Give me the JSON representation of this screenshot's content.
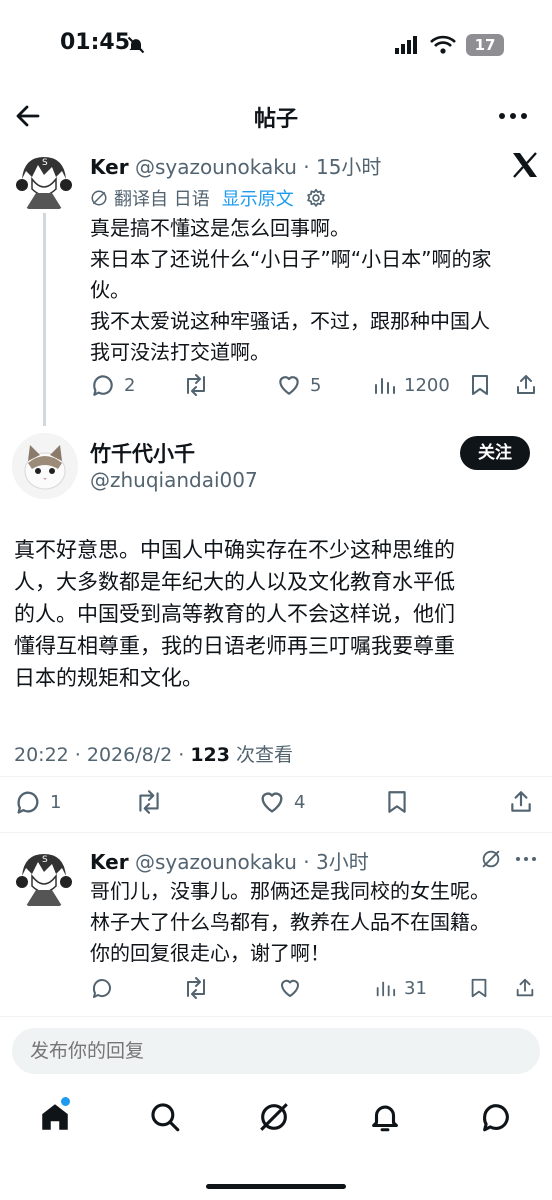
{
  "status_bar": {
    "time": "01:45",
    "battery": "17"
  },
  "header": {
    "title": "帖子"
  },
  "tweet1": {
    "display_name": "Ker",
    "handle": "@syazounokaku",
    "time": "15小时",
    "translated_label": "翻译自 日语",
    "show_original": "显示原文",
    "lines": [
      "真是搞不懂这是怎么回事啊。",
      "来日本了还说什么“小日子”啊“小日本”啊的家",
      "伙。",
      "我不太爱说这种牢骚话，不过，跟那种中国人",
      "我可没法打交道啊。"
    ],
    "replies": "2",
    "likes": "5",
    "views": "1200"
  },
  "main_tweet": {
    "display_name": "竹千代小千",
    "handle": "@zhuqiandai007",
    "follow_label": "关注",
    "lines": [
      "真不好意思。中国人中确实存在不少这种思维的",
      "人，大多数都是年纪大的人以及文化教育水平低",
      "的人。中国受到高等教育的人不会这样说，他们",
      "懂得互相尊重，我的日语老师再三叮嘱我要尊重",
      "日本的规矩和文化。"
    ],
    "meta_time": "20:22 · 2026/8/2 · ",
    "views_count": "123",
    "views_label": "次查看",
    "replies": "1",
    "likes": "4"
  },
  "reply": {
    "display_name": "Ker",
    "handle": "@syazounokaku",
    "time": "3小时",
    "lines": [
      "哥们儿，没事儿。那俩还是我同校的女生呢。",
      "林子大了什么鸟都有，教养在人品不在国籍。",
      "你的回复很走心，谢了啊！"
    ],
    "views": "31"
  },
  "composer": {
    "placeholder": "发布你的回复"
  },
  "colors": {
    "accent": "#1d9bf0",
    "text": "#0f1419",
    "muted": "#536471"
  }
}
